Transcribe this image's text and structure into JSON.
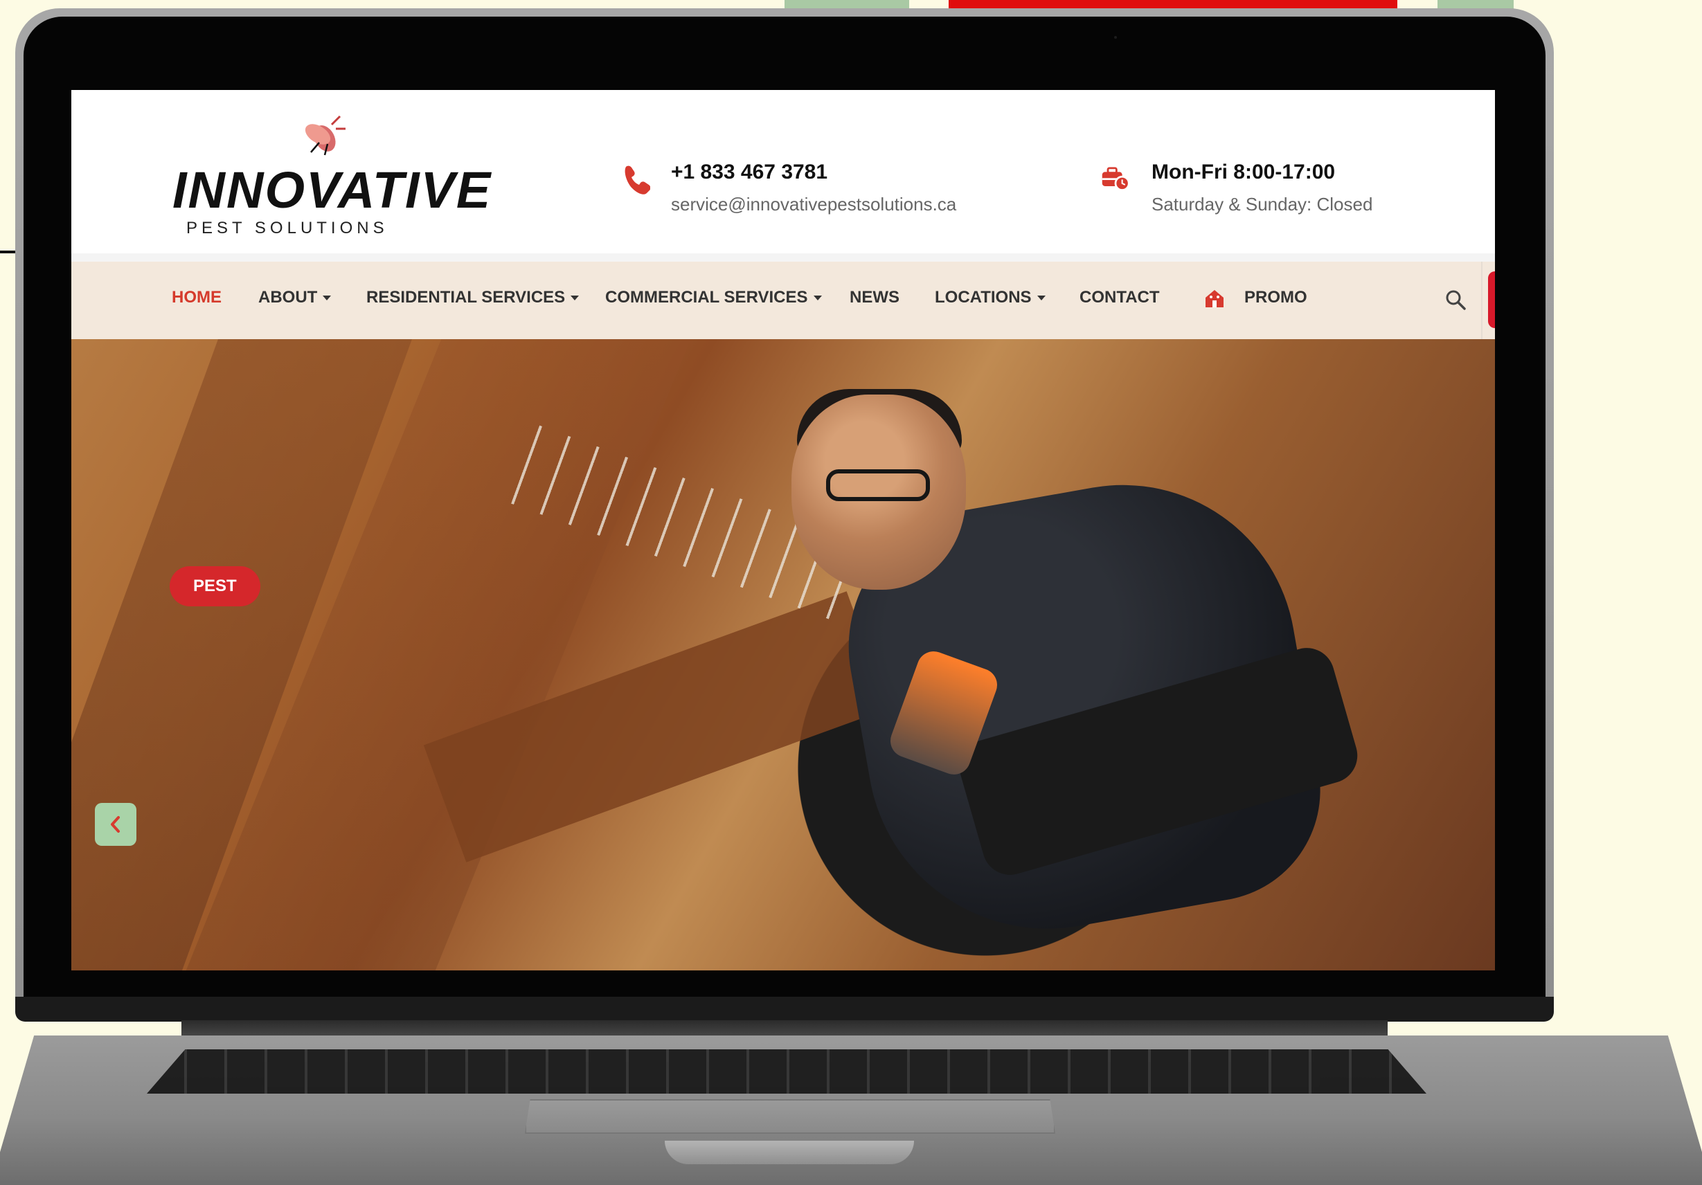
{
  "header": {
    "logo_main": "INNOVATIVE",
    "logo_sub": "PEST SOLUTIONS",
    "phone": "+1 833 467 3781",
    "email": "service@innovativepestsolutions.ca",
    "hours_weekdays": "Mon-Fri 8:00-17:00",
    "hours_weekend": "Saturday & Sunday: Closed"
  },
  "nav": {
    "items": [
      {
        "label": "HOME"
      },
      {
        "label": "ABOUT"
      },
      {
        "label": "RESIDENTIAL SERVICES"
      },
      {
        "label": "COMMERCIAL SERVICES"
      },
      {
        "label": "NEWS"
      },
      {
        "label": "LOCATIONS"
      },
      {
        "label": "CONTACT"
      },
      {
        "label": "PROMO"
      }
    ]
  },
  "hero": {
    "badge": "PEST"
  },
  "colors": {
    "accent": "#d5272b",
    "nav_active": "#d53a2b",
    "background": "#fdfbe4",
    "carousel_button": "#a9d3a8"
  },
  "icons": {
    "phone": "phone-icon",
    "hours": "briefcase-clock-icon",
    "promo": "promo-house-icon",
    "search": "search-icon",
    "prev": "chevron-left-icon"
  }
}
